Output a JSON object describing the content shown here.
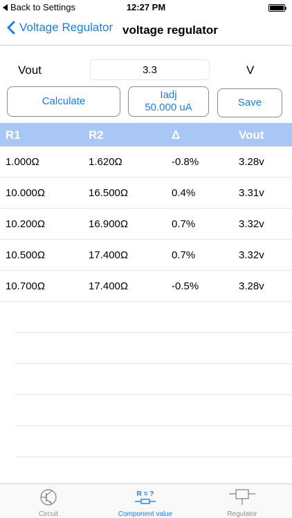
{
  "status_bar": {
    "back_label": "Back to Settings",
    "time": "12:27 PM"
  },
  "nav": {
    "back_label": "Voltage Regulator",
    "title": "voltage regulator"
  },
  "input": {
    "label": "Vout",
    "value": "3.3",
    "unit": "V"
  },
  "buttons": {
    "calculate": "Calculate",
    "iadj_line1": "Iadj",
    "iadj_line2": "50.000 uA",
    "save": "Save"
  },
  "table": {
    "headers": [
      "R1",
      "R2",
      "Δ",
      "Vout"
    ],
    "rows": [
      [
        "1.000Ω",
        "1.620Ω",
        "-0.8%",
        "3.28v"
      ],
      [
        "10.000Ω",
        "16.500Ω",
        "0.4%",
        "3.31v"
      ],
      [
        "10.200Ω",
        "16.900Ω",
        "0.7%",
        "3.32v"
      ],
      [
        "10.500Ω",
        "17.400Ω",
        "0.7%",
        "3.32v"
      ],
      [
        "10.700Ω",
        "17.400Ω",
        "-0.5%",
        "3.28v"
      ]
    ]
  },
  "tabs": {
    "circuit": "Circuit",
    "component_icon_text": "R = ?",
    "component": "Component value",
    "regulator": "Regulator"
  },
  "colors": {
    "accent": "#1a7ee6",
    "table_header_bg": "#a9c7f5",
    "inactive_tab": "#8e8e8e"
  }
}
